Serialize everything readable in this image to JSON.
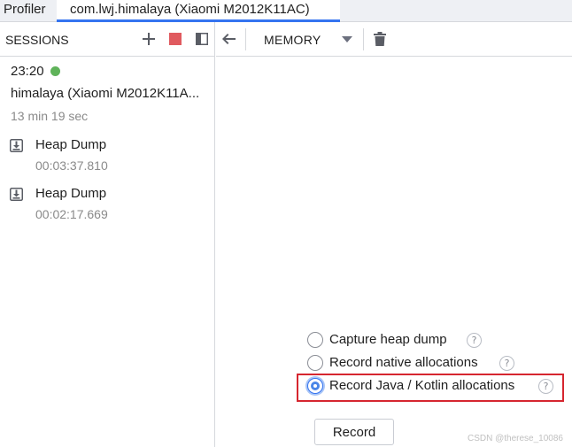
{
  "topbar": {
    "app_title": "Profiler",
    "tab_label": "com.lwj.himalaya (Xiaomi M2012K11AC)"
  },
  "sessions": {
    "header": "SESSIONS",
    "icons": [
      "plus-icon",
      "stop-icon",
      "panel-toggle-icon"
    ],
    "time": "23:20",
    "status_color": "#5fb35a",
    "name": "himalaya (Xiaomi M2012K11A...",
    "duration": "13 min 19 sec",
    "artifacts": [
      {
        "label": "Heap Dump",
        "time": "00:03:37.810"
      },
      {
        "label": "Heap Dump",
        "time": "00:02:17.669"
      }
    ]
  },
  "memory_toolbar": {
    "selector": "MEMORY",
    "icons": [
      "back-arrow-icon",
      "chevron-down-icon",
      "trash-icon"
    ]
  },
  "options": [
    {
      "label": "Capture heap dump",
      "checked": false
    },
    {
      "label": "Record native allocations",
      "checked": false
    },
    {
      "label": "Record Java / Kotlin allocations",
      "checked": true
    }
  ],
  "help_glyph": "?",
  "record_button": "Record",
  "watermark": "CSDN @therese_10086",
  "colors": {
    "accent": "#3574f0",
    "stop": "#e05a5f",
    "highlight": "#d6262f"
  }
}
